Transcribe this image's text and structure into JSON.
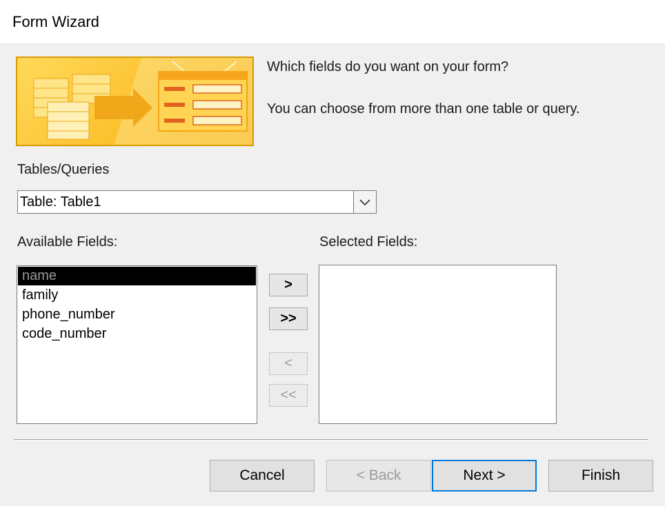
{
  "window": {
    "title": "Form Wizard"
  },
  "banner": {
    "icon": "form-wizard-table-to-form-icon"
  },
  "prompt": {
    "question": "Which fields do you want on your form?",
    "hint": "You can choose from more than one table or query."
  },
  "tables": {
    "label": "Tables/Queries",
    "selected": "Table: Table1"
  },
  "available": {
    "label": "Available Fields:",
    "items": [
      "name",
      "family",
      "phone_number",
      "code_number"
    ],
    "selected_index": 0
  },
  "selected_fields": {
    "label": "Selected Fields:",
    "items": []
  },
  "move_buttons": {
    "add_one": ">",
    "add_all": ">>",
    "remove_one": "<",
    "remove_all": "<<"
  },
  "footer": {
    "cancel": "Cancel",
    "back": "< Back",
    "next": "Next >",
    "finish": "Finish"
  },
  "colors": {
    "accent": "#0078d7",
    "banner": "#fcc12d",
    "selection": "#000000"
  }
}
